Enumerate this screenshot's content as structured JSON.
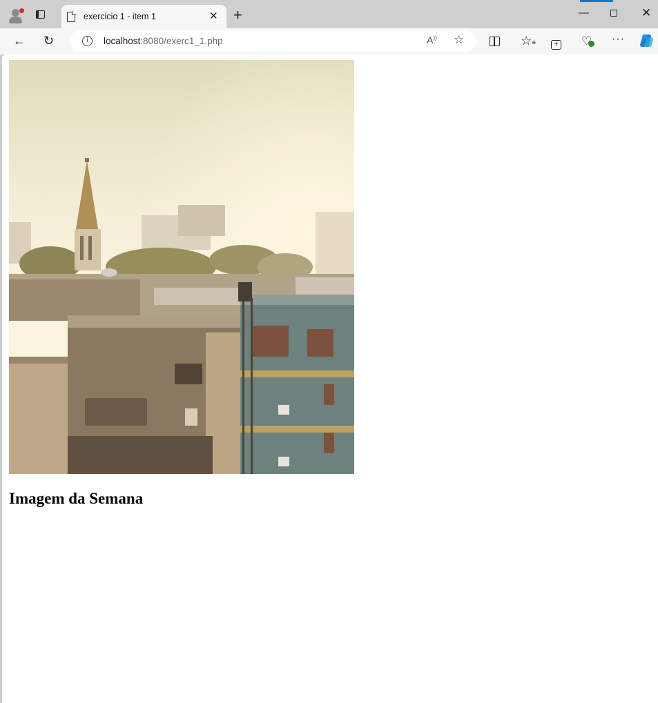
{
  "browser": {
    "tab_title": "exercicio 1 - item 1",
    "url_host": "localhost",
    "url_rest": ":8080/exerc1_1.php",
    "read_aloud_label": "A",
    "accent": "#0078d4"
  },
  "page": {
    "heading": "Imagem da Semana",
    "image_alt": "City skyline with church spire at sunset"
  }
}
